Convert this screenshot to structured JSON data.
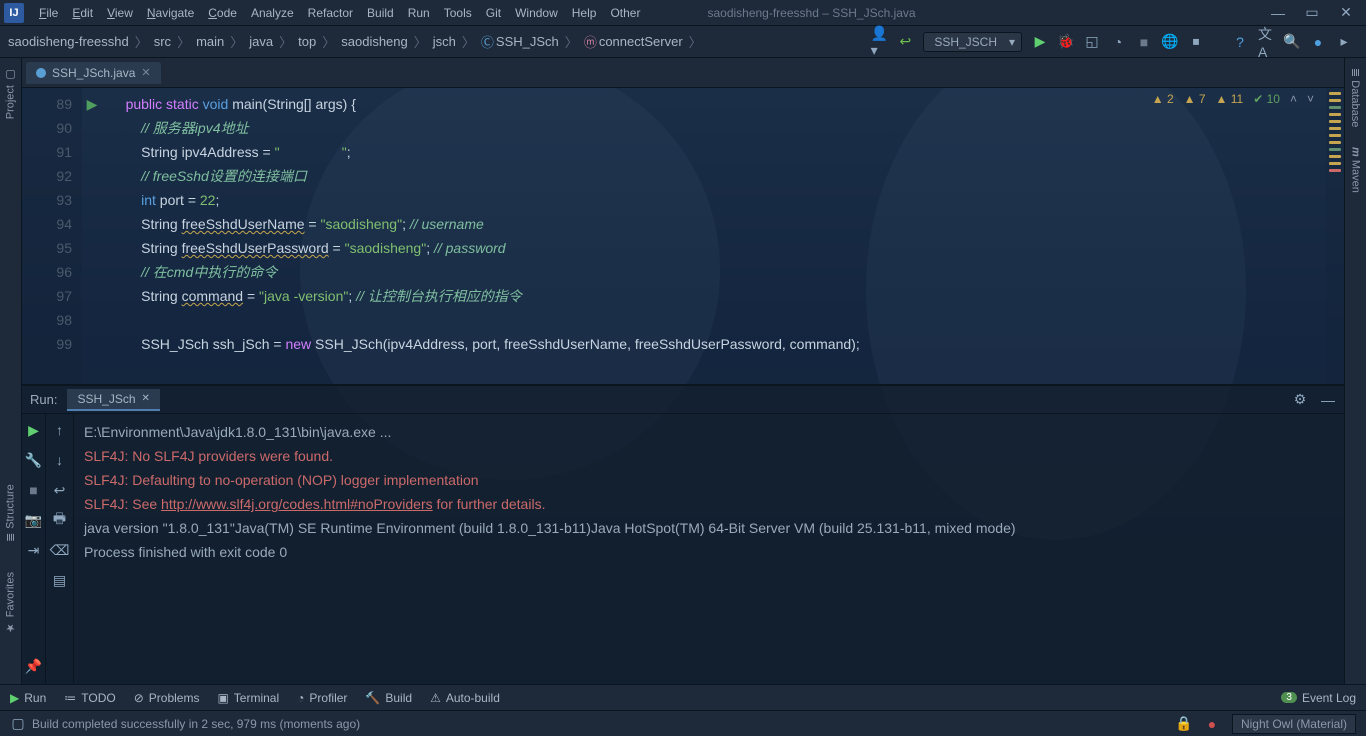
{
  "window": {
    "title": "saodisheng-freesshd – SSH_JSch.java"
  },
  "menus": [
    "File",
    "Edit",
    "View",
    "Navigate",
    "Code",
    "Analyze",
    "Refactor",
    "Build",
    "Run",
    "Tools",
    "Git",
    "Window",
    "Help",
    "Other"
  ],
  "menu_underline_index": [
    0,
    0,
    0,
    0,
    0,
    -1,
    -1,
    -1,
    -1,
    -1,
    -1,
    -1,
    -1,
    -1
  ],
  "breadcrumbs": [
    "saodisheng-freesshd",
    "src",
    "main",
    "java",
    "top",
    "saodisheng",
    "jsch",
    "SSH_JSch",
    "connectServer"
  ],
  "run_config": "SSH_JSCH",
  "file_tab": "SSH_JSch.java",
  "inspections": {
    "w1": "2",
    "w2": "7",
    "w3": "11",
    "ok": "10"
  },
  "lines": {
    "start": 89,
    "rows": [
      {
        "n": 89,
        "g": "▶",
        "html": "<span class='kw'>public</span> <span class='kw'>static</span> <span class='kw2'>void</span> main(String[] args) {"
      },
      {
        "n": 90,
        "html": "    <span class='cmt'>// 服务器ipv4地址</span>"
      },
      {
        "n": 91,
        "html": "    String ipv4Address = <span class='str'>\"                \"</span>;"
      },
      {
        "n": 92,
        "html": "    <span class='cmt'>// freeSshd设置的连接端口</span>"
      },
      {
        "n": 93,
        "html": "    <span class='kw2'>int</span> port = <span class='str'>22</span>;"
      },
      {
        "n": 94,
        "html": "    String <span class='wavy'>freeSshdUserName</span> = <span class='str'>\"saodisheng\"</span>; <span class='cmt'>// username</span>"
      },
      {
        "n": 95,
        "html": "    String <span class='wavy'>freeSshdUserPassword</span> = <span class='str'>\"saodisheng\"</span>; <span class='cmt'>// password</span>"
      },
      {
        "n": 96,
        "html": "    <span class='cmt'>// 在cmd中执行的命令</span>"
      },
      {
        "n": 97,
        "html": "    String <span class='wavy'>command</span> = <span class='str'>\"java -version\"</span>; <span class='cmt'>// 让控制台执行相应的指令</span>"
      },
      {
        "n": 98,
        "html": ""
      },
      {
        "n": 99,
        "html": "    SSH_JSch ssh_jSch = <span class='kw'>new</span> SSH_JSch(ipv4Address, port, freeSshdUserName, freeSshdUserPassword, command);"
      }
    ]
  },
  "run_panel": {
    "label": "Run:",
    "tab": "SSH_JSch",
    "lines": [
      {
        "cls": "",
        "t": "E:\\Environment\\Java\\jdk1.8.0_131\\bin\\java.exe ..."
      },
      {
        "cls": "err",
        "t": "SLF4J: No SLF4J providers were found."
      },
      {
        "cls": "err",
        "t": "SLF4J: Defaulting to no-operation (NOP) logger implementation"
      },
      {
        "cls": "err",
        "html": "SLF4J: See <span class='link'>http://www.slf4j.org/codes.html#noProviders</span> for further details."
      },
      {
        "cls": "",
        "t": "java version \"1.8.0_131\"Java(TM) SE Runtime Environment (build 1.8.0_131-b11)Java HotSpot(TM) 64-Bit Server VM (build 25.131-b11, mixed mode)"
      },
      {
        "cls": "",
        "t": ""
      },
      {
        "cls": "",
        "t": "Process finished with exit code 0"
      }
    ]
  },
  "left_tabs": [
    "Project",
    "Structure",
    "Favorites"
  ],
  "right_tabs": [
    "Database",
    "Maven"
  ],
  "bottom_tabs": [
    "Run",
    "TODO",
    "Problems",
    "Terminal",
    "Profiler",
    "Build",
    "Auto-build"
  ],
  "event_log": {
    "badge": "3",
    "label": "Event Log"
  },
  "status": {
    "msg": "Build completed successfully in 2 sec, 979 ms (moments ago)",
    "theme": "Night Owl (Material)"
  }
}
